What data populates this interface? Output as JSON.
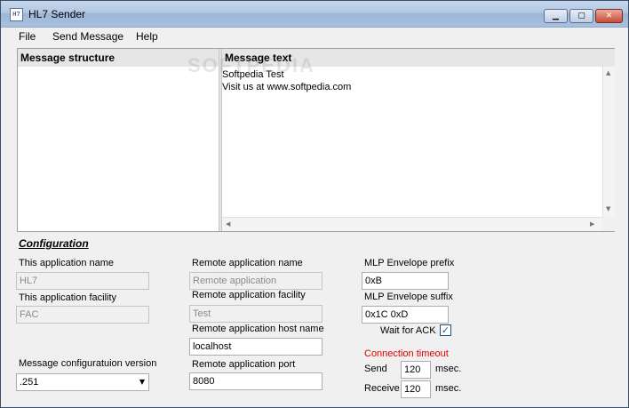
{
  "window": {
    "title": "HL7 Sender",
    "icon_text": "H7",
    "controls": {
      "minimize": "▁",
      "maximize": "▢",
      "close": "✕"
    }
  },
  "menu": [
    "File",
    "Send Message",
    "Help"
  ],
  "panes": {
    "structure_header": "Message structure",
    "message_header": "Message text",
    "message_lines": [
      "Softpedia Test",
      "Visit us at www.softpedia.com"
    ]
  },
  "watermark": "SOFTPEDIA",
  "configuration": {
    "title": "Configuration",
    "this_app_name_label": "This application name",
    "this_app_name_value": "HL7",
    "this_app_facility_label": "This application facility",
    "this_app_facility_value": "FAC",
    "config_version_label": "Message configuratuion version",
    "config_version_value": ".251",
    "remote_app_name_label": "Remote application name",
    "remote_app_name_value": "Remote application",
    "remote_app_facility_label": "Remote application facility",
    "remote_app_facility_value": "Test",
    "remote_host_label": "Remote application host name",
    "remote_host_value": "localhost",
    "remote_port_label": "Remote application port",
    "remote_port_value": "8080",
    "mlp_prefix_label": "MLP Envelope prefix",
    "mlp_prefix_value": "0xB",
    "mlp_suffix_label": "MLP Envelope suffix",
    "mlp_suffix_value": "0x1C 0xD",
    "wait_ack_label": "Wait for ACK",
    "wait_ack_checked": true,
    "wait_ack_mark": "✓",
    "timeout_title": "Connection timeout",
    "send_label": "Send",
    "send_value": "120",
    "receive_label": "Receive",
    "receive_value": "120",
    "unit": "msec."
  }
}
